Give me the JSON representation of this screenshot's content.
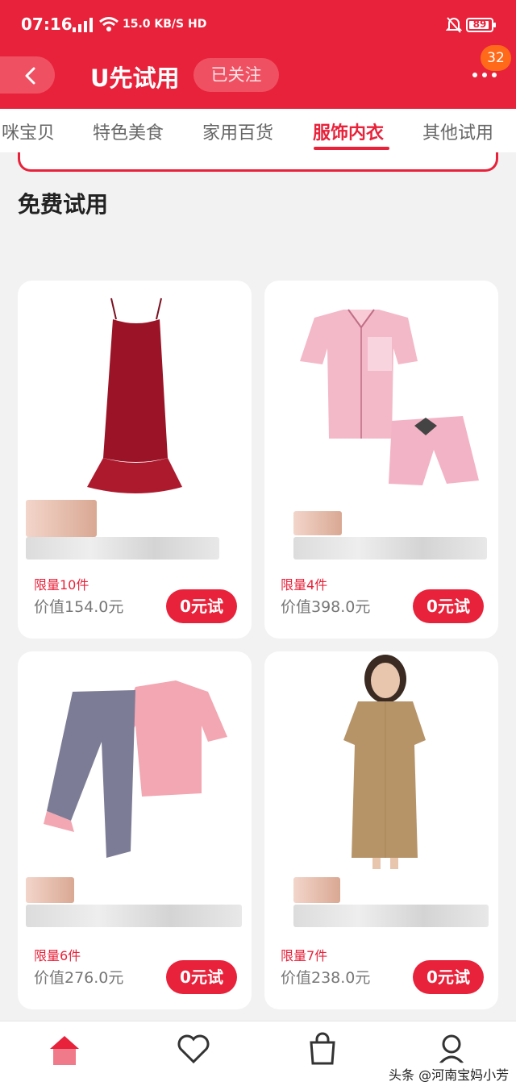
{
  "status_bar": {
    "time": "07:16",
    "network": "4G",
    "speed": "15.0 KB/S HD",
    "battery": "89"
  },
  "header": {
    "title": "U先试用",
    "follow_label": "已关注",
    "badge_count": "32"
  },
  "tabs": [
    {
      "label": "咪宝贝",
      "active": false
    },
    {
      "label": "特色美食",
      "active": false
    },
    {
      "label": "家用百货",
      "active": false
    },
    {
      "label": "服饰内衣",
      "active": true
    },
    {
      "label": "其他试用",
      "active": false
    }
  ],
  "section": {
    "title": "免费试用"
  },
  "products": [
    {
      "limit": "限量10件",
      "value": "价值154.0元",
      "button": "0元试"
    },
    {
      "limit": "限量4件",
      "value": "价值398.0元",
      "button": "0元试"
    },
    {
      "limit": "限量6件",
      "value": "价值276.0元",
      "button": "0元试"
    },
    {
      "limit": "限量7件",
      "value": "价值238.0元",
      "button": "0元试"
    }
  ],
  "bottom_nav": {
    "icons": [
      "home-icon",
      "heart-icon",
      "bag-icon",
      "profile-icon"
    ]
  },
  "watermark": "头条 @河南宝妈小芳",
  "colors": {
    "brand_red": "#e8223a",
    "badge_orange": "#ff6a1a"
  }
}
